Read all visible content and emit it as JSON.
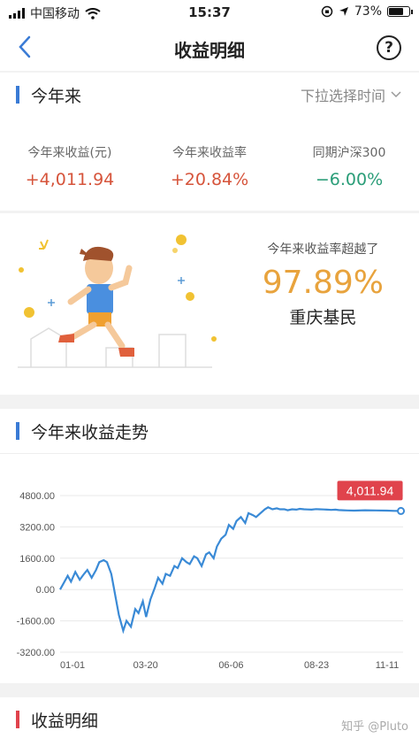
{
  "status_bar": {
    "carrier": "中国移动",
    "time": "15:37",
    "battery": "73%",
    "battery_level": 0.73
  },
  "nav": {
    "title": "收益明细",
    "help_symbol": "?"
  },
  "summary": {
    "section_title": "今年来",
    "time_selector": "下拉选择时间",
    "stats": [
      {
        "label": "今年来收益(元)",
        "value": "+4,011.94",
        "color": "#d6543b"
      },
      {
        "label": "今年来收益率",
        "value": "+20.84%",
        "color": "#d6543b"
      },
      {
        "label": "同期沪深300",
        "value": "−6.00%",
        "color": "#2a9d78"
      }
    ]
  },
  "promo": {
    "line1": "今年来收益率超越了",
    "percent": "97.89%",
    "line3": "重庆基民"
  },
  "trend": {
    "section_title": "今年来收益走势",
    "latest_badge": "4,011.94"
  },
  "detail": {
    "section_title": "收益明细"
  },
  "watermark": "知乎 @Pluto",
  "chart_data": {
    "type": "line",
    "title": "今年来收益走势",
    "x_tick_labels": [
      "01-01",
      "03-20",
      "06-06",
      "08-23",
      "11-11"
    ],
    "y_tick_labels": [
      "4800.00",
      "3200.00",
      "1600.00",
      "0.00",
      "-1600.00",
      "-3200.00"
    ],
    "ylim": [
      -3200,
      4800
    ],
    "x_range": [
      0,
      315
    ],
    "grid": true,
    "line_color": "#3a8ad6",
    "series": [
      {
        "x": [
          0,
          3,
          7,
          10,
          14,
          18,
          22,
          25,
          29,
          33,
          36,
          40,
          43,
          47,
          51,
          54,
          58,
          61,
          65,
          69,
          72,
          76,
          79,
          83,
          87,
          90,
          94,
          97,
          101,
          105,
          108,
          112,
          116,
          119,
          123,
          126,
          130,
          134,
          137,
          141,
          144,
          148,
          152,
          155,
          159,
          162,
          166,
          170,
          173,
          177,
          180,
          184,
          188,
          191,
          195,
          199,
          202,
          206,
          209,
          213,
          217,
          220,
          224,
          227,
          231,
          235,
          238,
          242,
          245,
          249,
          253,
          256,
          260,
          264,
          270,
          280,
          290,
          300,
          307,
          313
        ],
        "y": [
          0,
          300,
          700,
          400,
          900,
          500,
          800,
          1000,
          600,
          1000,
          1400,
          1500,
          1400,
          800,
          -400,
          -1300,
          -2100,
          -1600,
          -1900,
          -1000,
          -1200,
          -600,
          -1400,
          -500,
          100,
          600,
          300,
          800,
          700,
          1200,
          1100,
          1600,
          1400,
          1300,
          1700,
          1600,
          1200,
          1800,
          1900,
          1600,
          2200,
          2600,
          2800,
          3300,
          3100,
          3500,
          3700,
          3400,
          3900,
          3800,
          3700,
          3900,
          4100,
          4200,
          4100,
          4150,
          4100,
          4100,
          4050,
          4100,
          4080,
          4120,
          4100,
          4090,
          4080,
          4110,
          4100,
          4090,
          4080,
          4070,
          4080,
          4060,
          4050,
          4040,
          4030,
          4050,
          4040,
          4030,
          4020,
          4011.94
        ]
      }
    ]
  }
}
